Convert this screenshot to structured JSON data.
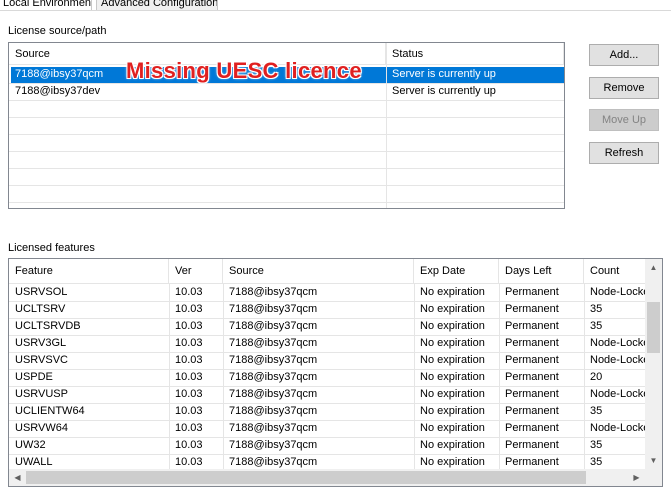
{
  "tabs": [
    {
      "label": "Local Environment",
      "active": true
    },
    {
      "label": "Advanced Configuration",
      "active": false
    }
  ],
  "license_sources": {
    "group_label": "License source/path",
    "columns": [
      "Source",
      "Status"
    ],
    "rows": [
      {
        "source": "7188@ibsy37qcm",
        "status": "Server is currently up",
        "selected": true
      },
      {
        "source": "7188@ibsy37dev",
        "status": "Server is currently up",
        "selected": false
      }
    ]
  },
  "annotation": "Missing UESC licence",
  "buttons": {
    "add": "Add...",
    "remove": "Remove",
    "move_up": "Move Up",
    "refresh": "Refresh"
  },
  "licensed_features": {
    "group_label": "Licensed features",
    "columns": [
      "Feature",
      "Ver",
      "Source",
      "Exp Date",
      "Days Left",
      "Count"
    ],
    "rows": [
      [
        "USRVSOL",
        "10.03",
        "7188@ibsy37qcm",
        "No expiration",
        "Permanent",
        "Node-Locked"
      ],
      [
        "UCLTSRV",
        "10.03",
        "7188@ibsy37qcm",
        "No expiration",
        "Permanent",
        "35"
      ],
      [
        "UCLTSRVDB",
        "10.03",
        "7188@ibsy37qcm",
        "No expiration",
        "Permanent",
        "35"
      ],
      [
        "USRV3GL",
        "10.03",
        "7188@ibsy37qcm",
        "No expiration",
        "Permanent",
        "Node-Locked"
      ],
      [
        "USRVSVC",
        "10.03",
        "7188@ibsy37qcm",
        "No expiration",
        "Permanent",
        "Node-Locked"
      ],
      [
        "USPDE",
        "10.03",
        "7188@ibsy37qcm",
        "No expiration",
        "Permanent",
        "20"
      ],
      [
        "USRVUSP",
        "10.03",
        "7188@ibsy37qcm",
        "No expiration",
        "Permanent",
        "Node-Locked"
      ],
      [
        "UCLIENTW64",
        "10.03",
        "7188@ibsy37qcm",
        "No expiration",
        "Permanent",
        "35"
      ],
      [
        "USRVW64",
        "10.03",
        "7188@ibsy37qcm",
        "No expiration",
        "Permanent",
        "Node-Locked"
      ],
      [
        "UW32",
        "10.03",
        "7188@ibsy37qcm",
        "No expiration",
        "Permanent",
        "35"
      ],
      [
        "UWALL",
        "10.03",
        "7188@ibsy37qcm",
        "No expiration",
        "Permanent",
        "35"
      ]
    ]
  },
  "colors": {
    "selection": "#0078d7",
    "annotation": "#e02020"
  },
  "icons": {
    "scroll_up": "triangle-up-icon",
    "scroll_down": "triangle-down-icon",
    "scroll_left": "triangle-left-icon",
    "scroll_right": "triangle-right-icon"
  }
}
